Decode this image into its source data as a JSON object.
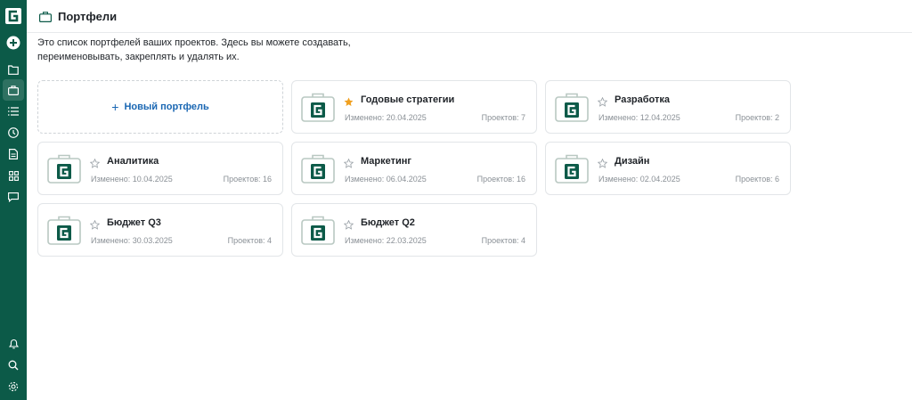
{
  "header": {
    "title": "Портфели"
  },
  "description": "Это список портфелей ваших проектов. Здесь вы можете создавать, переименовывать, закреплять и удалять их.",
  "new_portfolio": {
    "label": "Новый портфель"
  },
  "portfolios": [
    {
      "name": "Годовые стратегии",
      "modified": "Изменено: 20.04.2025",
      "count": "Проектов: 7",
      "starred": true
    },
    {
      "name": "Разработка",
      "modified": "Изменено: 12.04.2025",
      "count": "Проектов: 2",
      "starred": false
    },
    {
      "name": "Аналитика",
      "modified": "Изменено: 10.04.2025",
      "count": "Проектов: 16",
      "starred": false
    },
    {
      "name": "Маркетинг",
      "modified": "Изменено: 06.04.2025",
      "count": "Проектов: 16",
      "starred": false
    },
    {
      "name": "Дизайн",
      "modified": "Изменено: 02.04.2025",
      "count": "Проектов: 6",
      "starred": false
    },
    {
      "name": "Бюджет Q3",
      "modified": "Изменено: 30.03.2025",
      "count": "Проектов: 4",
      "starred": false
    },
    {
      "name": "Бюджет Q2",
      "modified": "Изменено: 22.03.2025",
      "count": "Проектов: 4",
      "starred": false
    }
  ],
  "colors": {
    "sidebar": "#0c5a48",
    "accent": "#1a67b3",
    "star": "#f0a020"
  }
}
